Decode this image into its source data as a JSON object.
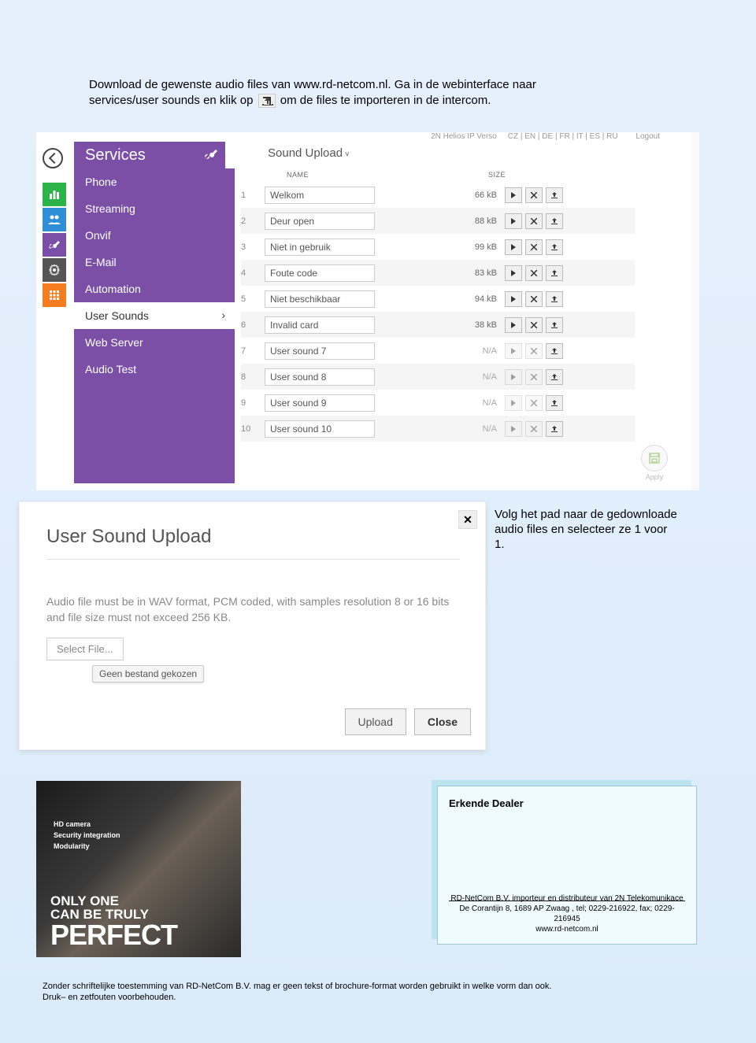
{
  "instruction_line1": "Download de gewenste audio files van www.rd-netcom.nl. Ga in de webinterface naar",
  "instruction_line2_pre": "services/user sounds en klik op",
  "instruction_line2_post": "om de files te importeren in de intercom.",
  "top_strip": {
    "product": "2N Helios IP Verso",
    "langs": "CZ | EN | DE | FR | IT | ES | RU",
    "logout": "Logout"
  },
  "services_title": "Services",
  "sidebar": {
    "items": [
      "Phone",
      "Streaming",
      "Onvif",
      "E-Mail",
      "Automation",
      "User Sounds",
      "Web Server",
      "Audio Test"
    ],
    "active_index": 5
  },
  "content_title": "Sound Upload",
  "table_headers": {
    "name": "NAME",
    "size": "SIZE"
  },
  "rows": [
    {
      "num": "1",
      "name": "Welkom",
      "size": "66 kB",
      "na": false
    },
    {
      "num": "2",
      "name": "Deur open",
      "size": "88 kB",
      "na": false
    },
    {
      "num": "3",
      "name": "Niet in gebruik",
      "size": "99 kB",
      "na": false
    },
    {
      "num": "4",
      "name": "Foute code",
      "size": "83 kB",
      "na": false
    },
    {
      "num": "5",
      "name": "Niet beschikbaar",
      "size": "94 kB",
      "na": false
    },
    {
      "num": "6",
      "name": "Invalid card",
      "size": "38 kB",
      "na": false
    },
    {
      "num": "7",
      "name": "User sound 7",
      "size": "N/A",
      "na": true
    },
    {
      "num": "8",
      "name": "User sound 8",
      "size": "N/A",
      "na": true
    },
    {
      "num": "9",
      "name": "User sound 9",
      "size": "N/A",
      "na": true
    },
    {
      "num": "10",
      "name": "User sound 10",
      "size": "N/A",
      "na": true
    }
  ],
  "apply_label": "Apply",
  "dialog": {
    "title": "User Sound Upload",
    "desc": "Audio file must be in WAV format, PCM coded, with samples resolution 8 or 16 bits and file size must not exceed 256 KB.",
    "select_file": "Select File...",
    "chosen": "Geen bestand gekozen",
    "upload": "Upload",
    "close": "Close"
  },
  "dialog_note": "Volg het pad naar de gedownloade audio files en selecteer ze 1 voor 1.",
  "ad": {
    "lines": [
      "HD camera",
      "Security integration",
      "Modularity"
    ],
    "big1": "ONLY ONE",
    "big2": "CAN BE TRULY",
    "big3": "PERFECT"
  },
  "dealer": {
    "title": "Erkende Dealer",
    "contact_l1": "RD-NetCom B.V. importeur en distributeur van 2N Telekomunikace",
    "contact_l2": "De Corantijn 8, 1689 AP Zwaag , tel;  0229-216922, fax; 0229-216945",
    "contact_l3": "www.rd-netcom.nl"
  },
  "footer_l1": "Zonder schriftelijke toestemming van RD-NetCom B.V. mag er geen tekst of brochure-format worden gebruikt in welke vorm dan ook.",
  "footer_l2": "Druk– en zetfouten voorbehouden."
}
